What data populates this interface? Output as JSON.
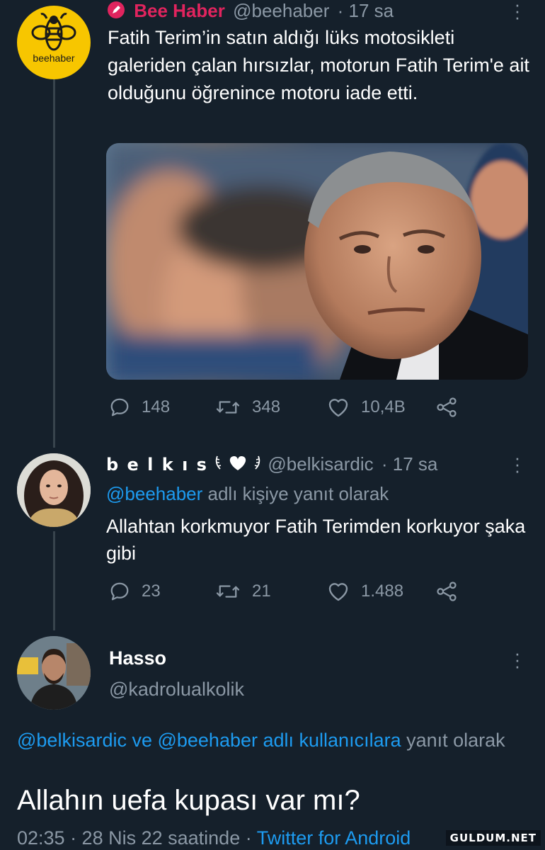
{
  "tweet1": {
    "avatar_text": "beehaber",
    "name": "Bee Haber",
    "handle": "@beehaber",
    "time": "· 17 sa",
    "text": "Fatih Terim’in satın aldığı lüks motosikleti galeriden çalan hırsızlar, motorun Fatih Terim'e ait olduğunu öğrenince motoru iade etti.",
    "replies": "148",
    "retweets": "348",
    "likes": "10,4B"
  },
  "tweet2": {
    "name": "b e l k ı s",
    "handle": "@belkisardic",
    "time": "· 17 sa",
    "reply_to_handle": "@beehaber",
    "reply_to_suffix": " adlı kişiye yanıt olarak",
    "text": "Allahtan korkmuyor Fatih Terimden korkuyor şaka gibi",
    "replies": "23",
    "retweets": "21",
    "likes": "1.488"
  },
  "tweet3": {
    "name": "Hasso",
    "handle": "@kadrolualkolik",
    "reply_links": "@belkisardic ve @beehaber adlı kullanıcılara",
    "reply_suffix": " yanıt olarak",
    "text": "Allahın uefa kupası var mı?",
    "timestamp": "02:35 · 28 Nis 22 saatinde · ",
    "source": "Twitter for Android"
  },
  "watermark": "GULDUM.NET",
  "colors": {
    "background": "#15202b",
    "secondary_text": "#8b98a5",
    "link": "#1d9bf0",
    "brand_pink": "#e0245e",
    "bee_yellow": "#f7c600"
  }
}
